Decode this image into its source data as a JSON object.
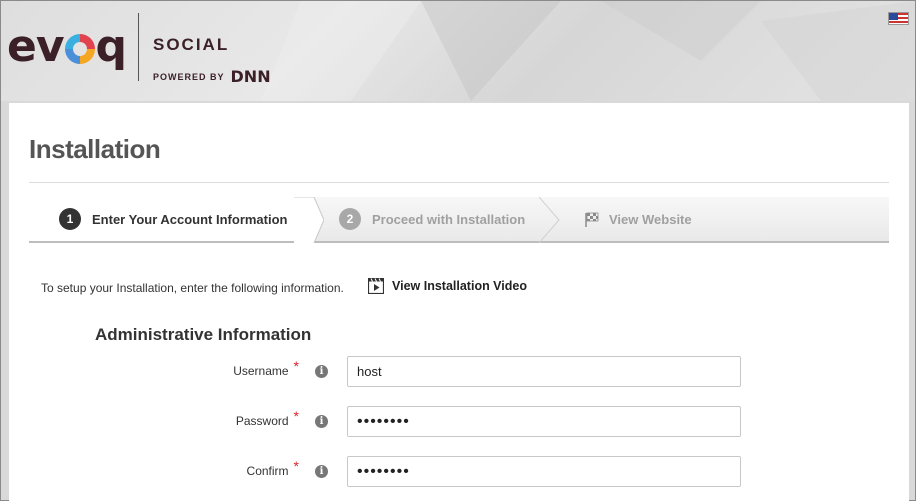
{
  "header": {
    "logo_text_prefix": "ev",
    "logo_text_suffix": "q",
    "logo_product": "SOCIAL",
    "logo_powered_by": "POWERED BY",
    "logo_dnn": "DNN",
    "language_flag_icon": "us-flag-icon"
  },
  "page": {
    "title": "Installation"
  },
  "wizard": {
    "steps": [
      {
        "number": "1",
        "label": "Enter Your Account Information",
        "state": "active"
      },
      {
        "number": "2",
        "label": "Proceed with Installation",
        "state": "inactive"
      },
      {
        "icon": "checkered-flag-icon",
        "label": "View Website",
        "state": "inactive"
      }
    ]
  },
  "intro": {
    "text": "To setup your Installation, enter the following information.",
    "video_link_label": "View Installation Video",
    "video_icon": "film-icon"
  },
  "admin": {
    "section_title": "Administrative Information",
    "fields": [
      {
        "label": "Username",
        "required": "*",
        "value": "host",
        "type": "text"
      },
      {
        "label": "Password",
        "required": "*",
        "value": "••••••••",
        "type": "password"
      },
      {
        "label": "Confirm",
        "required": "*",
        "value": "••••••••",
        "type": "password"
      }
    ]
  },
  "colors": {
    "required_marker": "#d9252a",
    "active_step": "#333333",
    "inactive_step": "#a0a0a0"
  }
}
